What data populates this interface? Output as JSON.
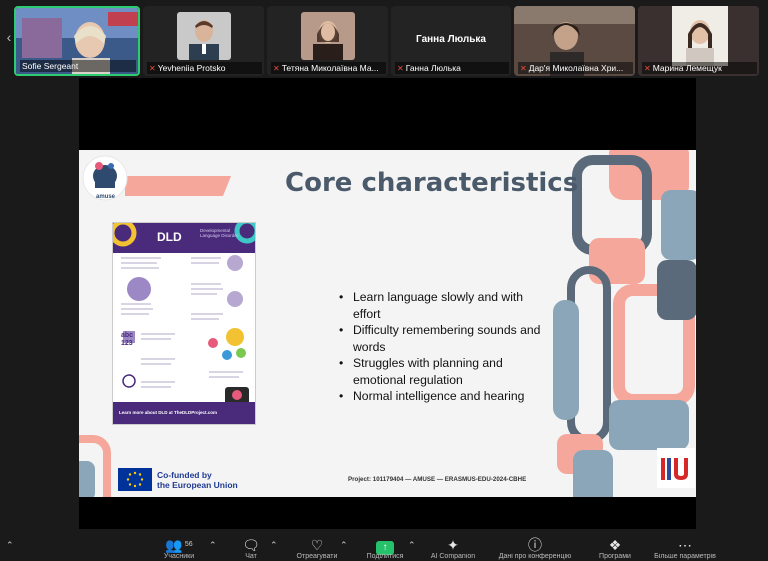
{
  "participants": [
    {
      "name": "Sofie Sergeant",
      "muted": false,
      "active": true
    },
    {
      "name": "Yevheniia Protsko",
      "muted": true,
      "active": false
    },
    {
      "name": "Тетяна Миколаївна Ма...",
      "muted": true,
      "active": false
    },
    {
      "name": "Ганна Люлька",
      "muted": true,
      "active": false,
      "center_label": "Ганна Люлька"
    },
    {
      "name": "Дар'я Миколаївна Хри...",
      "muted": true,
      "active": false
    },
    {
      "name": "Марина Лемещук",
      "muted": true,
      "active": false
    }
  ],
  "slide": {
    "title": "Core characteristics",
    "bullets": [
      "Learn language slowly and with effort",
      "Difficulty remembering sounds and words",
      "Struggles with planning and emotional regulation",
      "Normal intelligence and hearing"
    ],
    "logo_text": "amuse",
    "project": "Project: 101179404 — AMUSE — ERASMUS-EDU-2024-CBHE",
    "eu_line1": "Co-funded by",
    "eu_line2": "the European Union",
    "iu_logo": "IU",
    "infographic": {
      "title": "DLD",
      "subtitle_1": "Developmental",
      "subtitle_2": "Language Disorder",
      "footer": "Learn more about DLD at TheDLDProject.com",
      "abc": "abc",
      "num": "123"
    }
  },
  "toolbar": {
    "participants_count": "56",
    "items": [
      {
        "label": "Учасники",
        "icon": "participants-icon"
      },
      {
        "label": "Чат",
        "icon": "chat-icon"
      },
      {
        "label": "Отреагувати",
        "icon": "react-icon"
      },
      {
        "label": "Поділитися",
        "icon": "share-icon"
      },
      {
        "label": "AI Companion",
        "icon": "ai-icon"
      },
      {
        "label": "Дані про конференцію",
        "icon": "info-icon"
      },
      {
        "label": "Програми",
        "icon": "apps-icon"
      },
      {
        "label": "Більше параметрів",
        "icon": "more-icon"
      }
    ]
  },
  "colors": {
    "accent_green": "#2ecc71",
    "share_green": "#26c16b",
    "slide_title": "#4a5a6a",
    "dld_purple": "#4a2a7a",
    "salmon": "#f4a79a",
    "slate": "#5a6a7a",
    "steel": "#8aa6b8"
  }
}
